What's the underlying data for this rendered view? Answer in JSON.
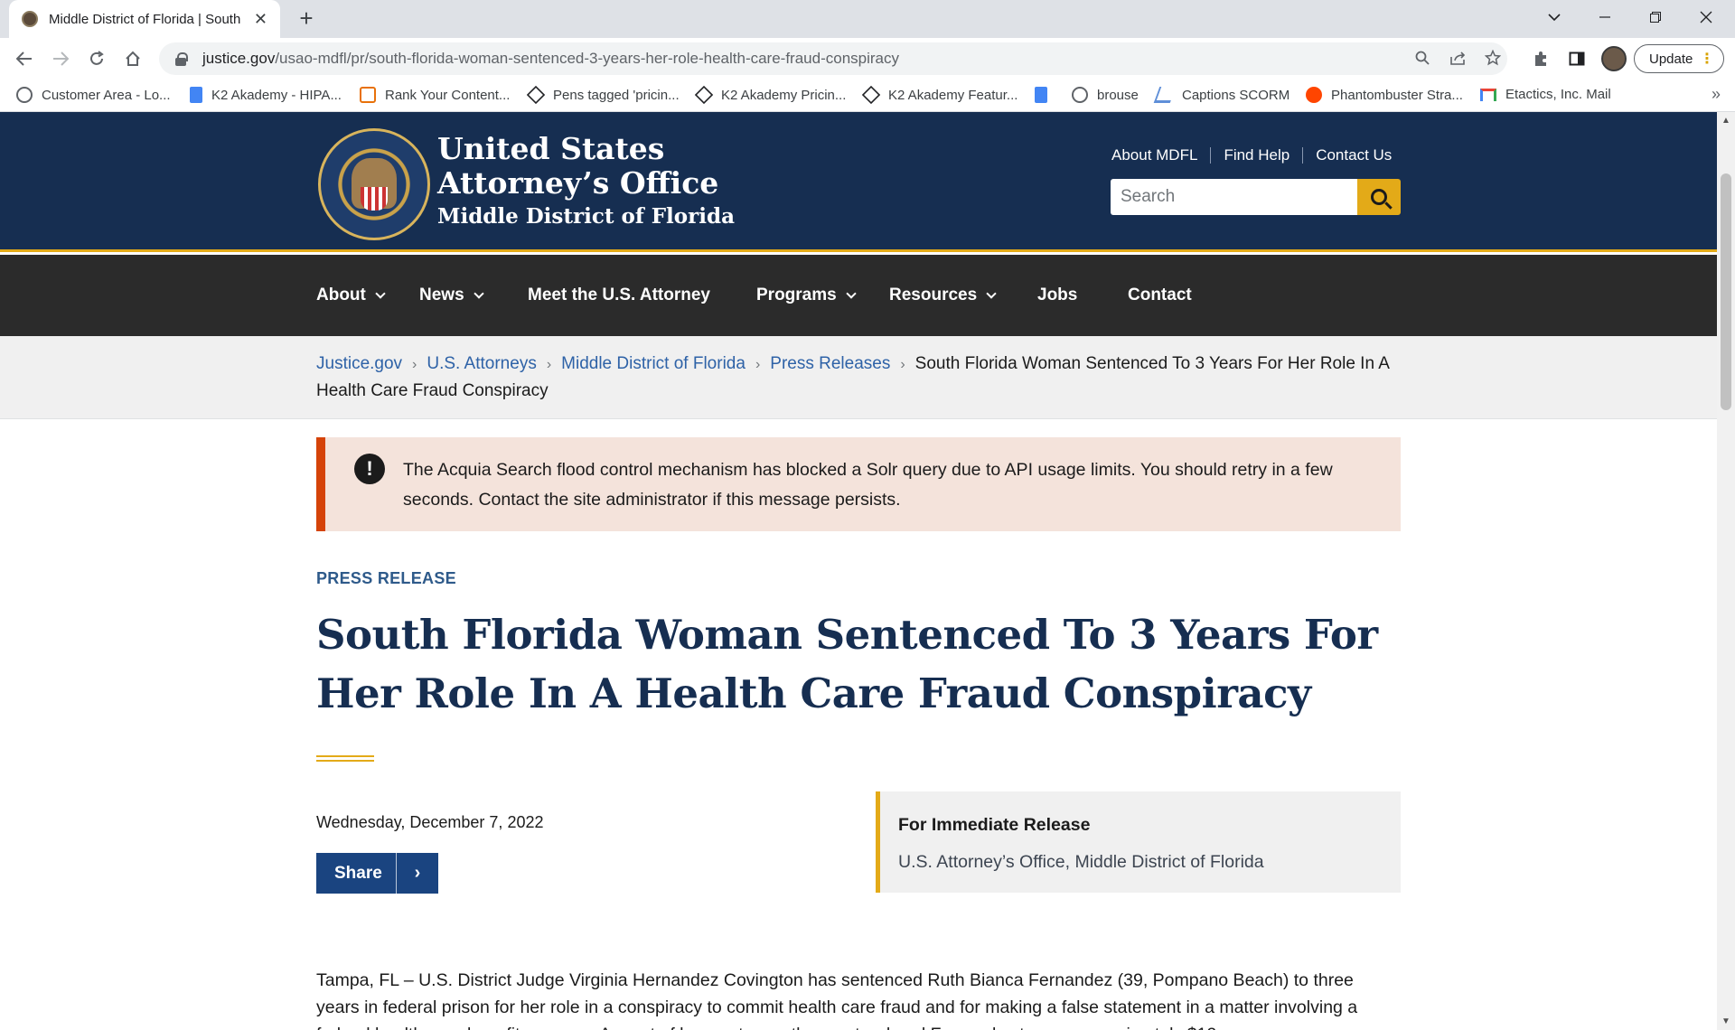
{
  "browser": {
    "tab_title": "Middle District of Florida | South",
    "tab_close": "✕",
    "new_tab": "+",
    "url_host": "justice.gov",
    "url_path": "/usao-mdfl/pr/south-florida-woman-sentenced-3-years-her-role-health-care-fraud-conspiracy",
    "update_label": "Update",
    "bookmarks": [
      {
        "label": "Customer Area - Lo...",
        "icon": "globe-icon",
        "color": "#5f6368"
      },
      {
        "label": "K2 Akademy - HIPA...",
        "icon": "docs-icon",
        "color": "#4285f4"
      },
      {
        "label": "Rank Your Content...",
        "icon": "calendar-icon",
        "color": "#e8710a"
      },
      {
        "label": "Pens tagged 'pricin...",
        "icon": "codepen-icon",
        "color": "#202124"
      },
      {
        "label": "K2 Akademy Pricin...",
        "icon": "codepen-icon",
        "color": "#202124"
      },
      {
        "label": "K2 Akademy Featur...",
        "icon": "codepen-icon",
        "color": "#202124"
      },
      {
        "label": "",
        "icon": "docs-icon",
        "color": "#4285f4"
      },
      {
        "label": "brouse",
        "icon": "globe-icon",
        "color": "#5f6368"
      },
      {
        "label": "Captions SCORM",
        "icon": "captions-icon",
        "color": "#5f8fd8"
      },
      {
        "label": "Phantombuster Stra...",
        "icon": "reddit-icon",
        "color": "#ff4500"
      },
      {
        "label": "Etactics, Inc. Mail",
        "icon": "gmail-icon",
        "color": "#ea4335"
      }
    ],
    "bookmarks_more": "»"
  },
  "header": {
    "office_line1": "United States",
    "office_line2": "Attorney’s Office",
    "office_line3": "Middle District of Florida",
    "util_links": [
      "About MDFL",
      "Find Help",
      "Contact Us"
    ],
    "search_placeholder": "Search"
  },
  "nav": {
    "items": [
      {
        "label": "About",
        "dropdown": true
      },
      {
        "label": "News",
        "dropdown": true
      },
      {
        "label": "Meet the U.S. Attorney",
        "dropdown": false
      },
      {
        "label": "Programs",
        "dropdown": true
      },
      {
        "label": "Resources",
        "dropdown": true
      },
      {
        "label": "Jobs",
        "dropdown": false
      },
      {
        "label": "Contact",
        "dropdown": false
      }
    ]
  },
  "breadcrumb": {
    "links": [
      "Justice.gov",
      "U.S. Attorneys",
      "Middle District of Florida",
      "Press Releases"
    ],
    "current": "South Florida Woman Sentenced To 3 Years For Her Role In A Health Care Fraud Conspiracy"
  },
  "alert": {
    "icon": "!",
    "text": "The Acquia Search flood control mechanism has blocked a Solr query due to API usage limits. You should retry in a few seconds. Contact the site administrator if this message persists."
  },
  "article": {
    "kicker": "PRESS RELEASE",
    "headline": "South Florida Woman Sentenced To 3 Years For Her Role In A Health Care Fraud Conspiracy",
    "date": "Wednesday, December 7, 2022",
    "share_label": "Share",
    "share_arrow": "›",
    "release_title": "For Immediate Release",
    "release_sub": "U.S. Attorney’s Office, Middle District of Florida",
    "body": "Tampa, FL – U.S. District Judge Virginia Hernandez Covington has sentenced Ruth Bianca Fernandez (39, Pompano Beach) to three years in federal prison for her role in a conspiracy to commit health care fraud and for making a false statement in a matter involving a federal health care benefit program. As part of her sentence, the court ordered Fernandez to pay approximately $12"
  }
}
